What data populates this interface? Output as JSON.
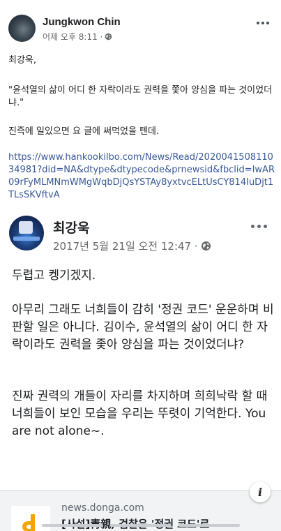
{
  "post": {
    "author": "Jungkwon Chin",
    "time": "어제 오후 8:11 · ",
    "paragraph1": "최강욱,",
    "paragraph2": "\"윤석열의 삶이 어디 한 자락이라도 권력을 쫓아 양심을 파는 것이었더냐.\"",
    "paragraph3": "진즉에 일있으면 요 글에 써먹었을 텐데.",
    "link": "https://www.hankookilbo.com/News/Read/202004150811034981?did=NA&dtype&dtypecode&prnewsid&fbclid=IwAR09rFyMLMNmWMgWqbDjQsYSTAy8yxtvcELtUsCY814IuDjt1TLsSKVftvA"
  },
  "shared_post": {
    "author": "최강욱",
    "time": "2017년 5월 21일 오전 12:47 · ",
    "line1": "두렵고 켕기겠지.",
    "paragraph2": "아무리 그래도 너희들이 감히 '정권 코드' 운운하며 비판할 일은 아니다. 김이수, 윤석열의 삶이 어디 한 자락이라도 권력을 좇아 양심을 파는 것이었더냐?",
    "paragraph3": "진짜 권력의 개들이 자리를 차지하며 희희낙락 할 때 너희들이 보인 모습을 우리는 뚜렷이 기억한다. You are not alone~."
  },
  "link_preview": {
    "domain": "news.donga.com",
    "title": "[사설]靑親, 검찰은 '정권 코드'로",
    "info_label": "i"
  },
  "icons": {
    "globe": "globe-icon",
    "more": "more-options-icon",
    "info": "info-icon"
  },
  "colors": {
    "link": "#385898",
    "secondary_text": "#65676b",
    "preview_bg": "#f2f3f5"
  }
}
